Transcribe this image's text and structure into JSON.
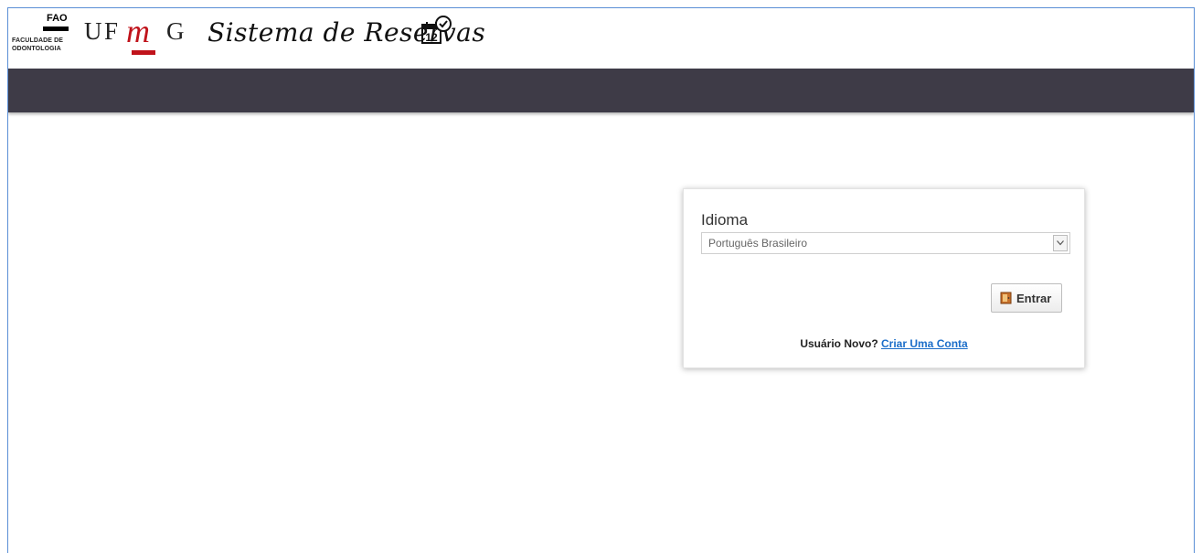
{
  "header": {
    "fao_logo": {
      "acronym": "FAO",
      "line1": "FACULDADE DE",
      "line2": "ODONTOLOGIA"
    },
    "ufmg_logo": {
      "u": "U",
      "f": "F",
      "m": "m",
      "g": "G"
    },
    "system_title": "Sistema de Reservas",
    "calendar_icon": {
      "name": "calendar-clock-icon",
      "day": "12"
    }
  },
  "login_card": {
    "language_label": "Idioma",
    "language_select": {
      "selected": "Português Brasileiro"
    },
    "submit_button": {
      "label": "Entrar",
      "icon": "door-icon"
    },
    "signup": {
      "prompt": "Usuário Novo?",
      "link_text": "Criar Uma Conta"
    }
  },
  "colors": {
    "navbar": "#3e3b47",
    "ufmg_red": "#c0131b",
    "link": "#1c6ec9",
    "frame_border": "#5b8fd6"
  }
}
